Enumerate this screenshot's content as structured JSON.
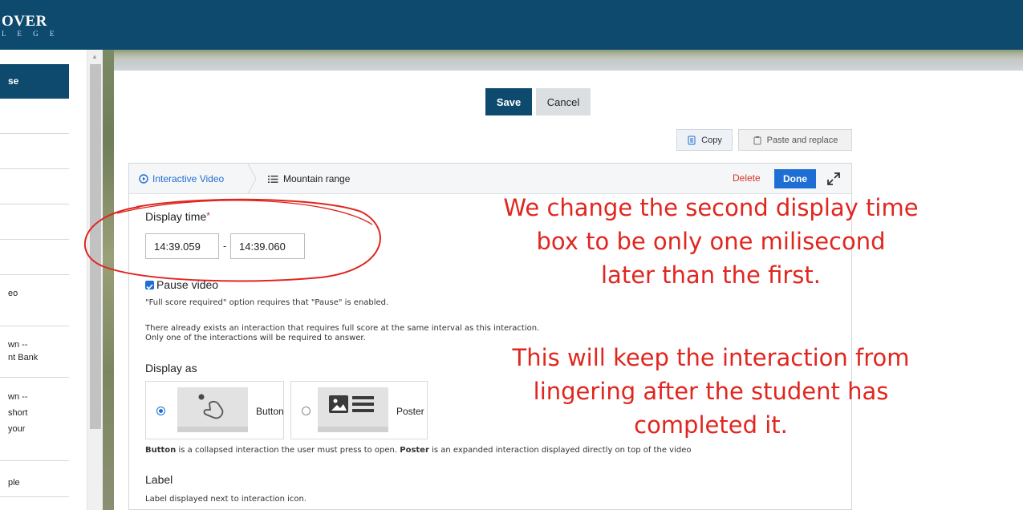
{
  "header": {
    "logo_main": "OVER",
    "logo_sub": "L E G E"
  },
  "sidebar": {
    "active_label": "se",
    "items": [
      "eo",
      "wn --",
      "nt Bank",
      "wn --",
      "short",
      "your",
      "ple"
    ]
  },
  "toolbar": {
    "save_label": "Save",
    "cancel_label": "Cancel",
    "copy_label": "Copy",
    "paste_label": "Paste and replace"
  },
  "editor": {
    "breadcrumb_parent": "Interactive Video",
    "breadcrumb_current": "Mountain range",
    "delete_label": "Delete",
    "done_label": "Done",
    "display_time_label": "Display time",
    "required_marker": "*",
    "time_start": "14:39.059",
    "time_separator": "-",
    "time_end": "14:39.060",
    "pause_label": "Pause video",
    "pause_checked": true,
    "pause_note": "\"Full score required\" option requires that \"Pause\" is enabled.",
    "warning_line1": "There already exists an interaction that requires full score at the same interval as this interaction.",
    "warning_line2": "Only one of the interactions will be required to answer.",
    "display_as_label": "Display as",
    "options": [
      {
        "label": "Button",
        "selected": true
      },
      {
        "label": "Poster",
        "selected": false
      }
    ],
    "display_help_b1": "Button",
    "display_help_t1": " is a collapsed interaction the user must press to open. ",
    "display_help_b2": "Poster",
    "display_help_t2": " is an expanded interaction displayed directly on top of the video",
    "label_heading": "Label",
    "label_help": "Label displayed next to interaction icon."
  },
  "annotation": {
    "note1": [
      "We change the second display time",
      "box to be only one milisecond",
      "later than the first."
    ],
    "note2": [
      "This will keep the interaction from",
      "lingering after the student has",
      "completed it."
    ],
    "color": "#e0261f"
  }
}
